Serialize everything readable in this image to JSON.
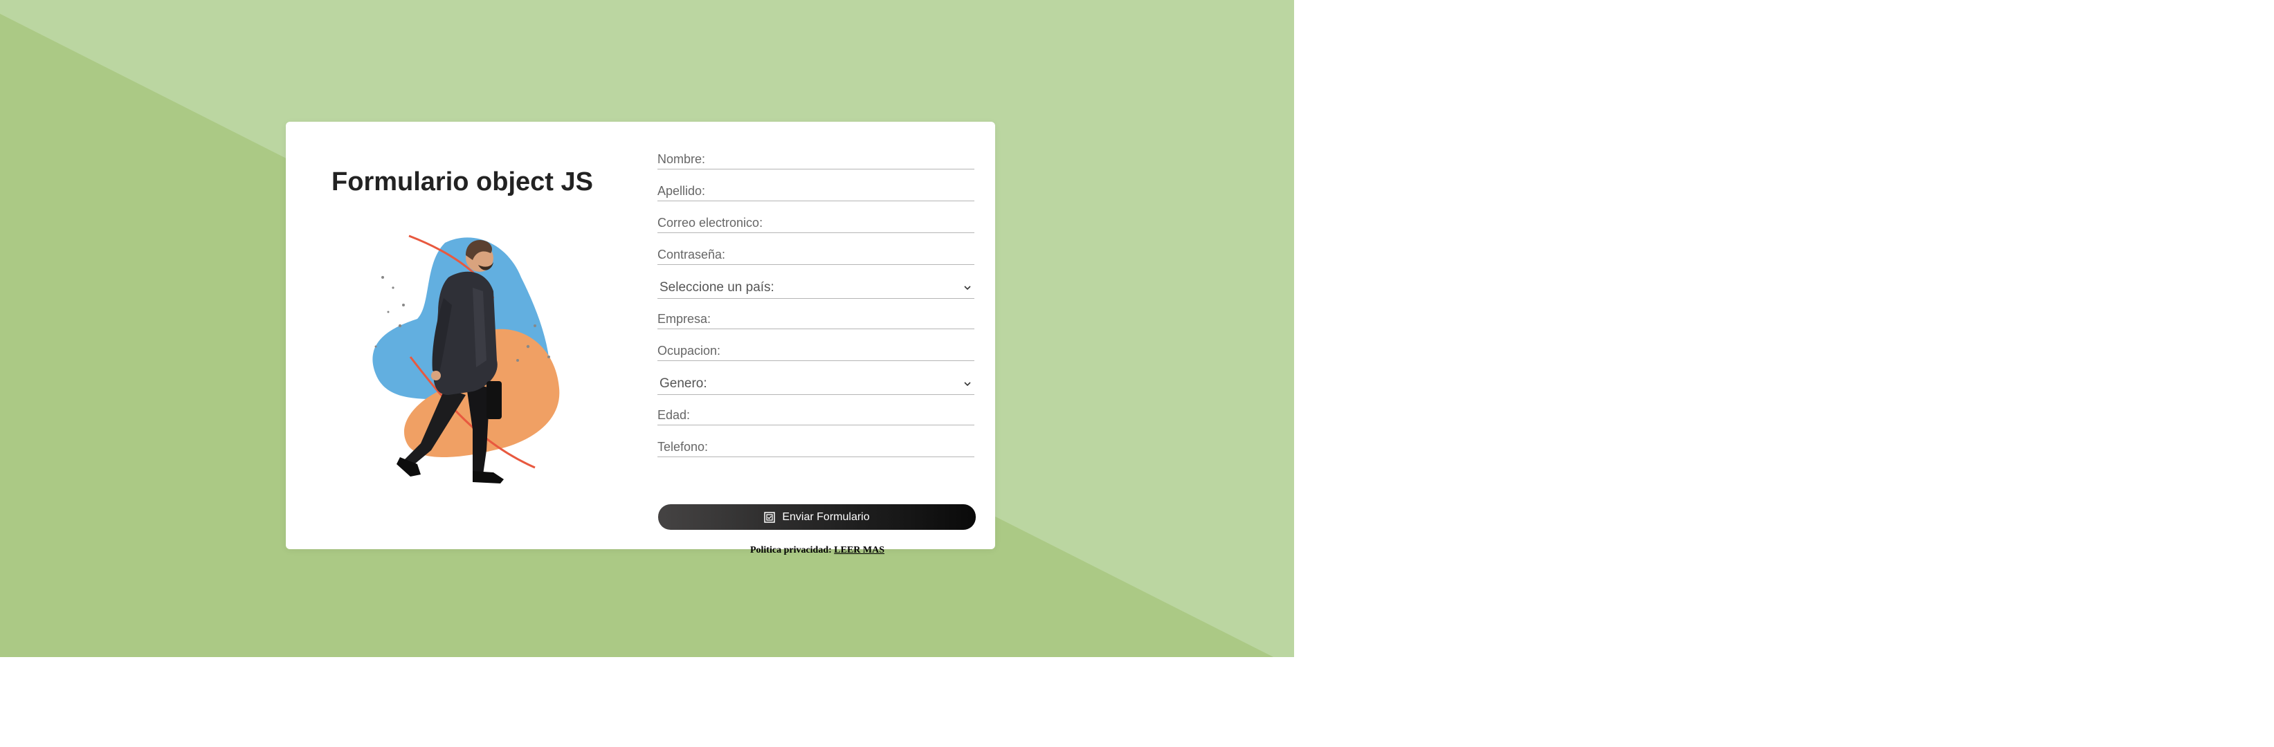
{
  "header": {
    "title": "Formulario object JS"
  },
  "form": {
    "fields": [
      {
        "placeholder": "Nombre:"
      },
      {
        "placeholder": "Apellido:"
      },
      {
        "placeholder": "Correo electronico:"
      },
      {
        "placeholder": "Contraseña:"
      }
    ],
    "country_select": {
      "selected": "Seleccione un país:"
    },
    "fields2": [
      {
        "placeholder": "Empresa:"
      },
      {
        "placeholder": "Ocupacion:"
      }
    ],
    "gender_select": {
      "selected": "Genero:"
    },
    "fields3": [
      {
        "placeholder": "Edad:"
      },
      {
        "placeholder": "Telefono:"
      }
    ],
    "submit_label": "Enviar Formulario"
  },
  "privacy": {
    "label": "Politica privacidad:",
    "link": "LEER MAS"
  },
  "icons": {
    "submit": "checkbox-icon",
    "select": "chevron-down-icon"
  },
  "colors": {
    "background": "#abc985",
    "background_light": "#bbd6a1",
    "card": "#ffffff",
    "button_dark": "#0a0a0a",
    "blob_blue": "#62afe0",
    "blob_orange": "#f0a064"
  }
}
